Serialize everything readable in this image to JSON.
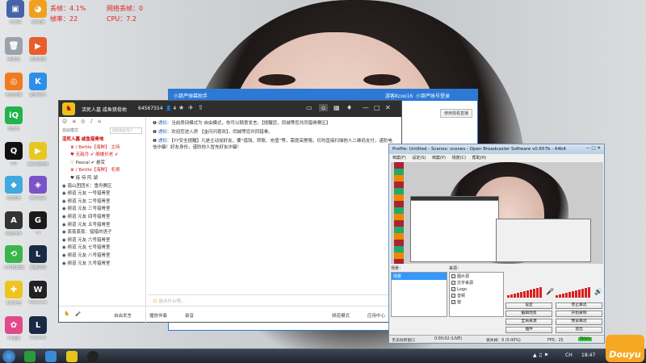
{
  "stats": {
    "dropped": "丢帧：4.1%",
    "lost": "网络丢帧：0",
    "fps": "帧率：22",
    "cpu": "CPU：7.2"
  },
  "desktop_icons": [
    "计算机",
    "Wi快速",
    "回收站",
    "迅雷直播",
    "热血直播",
    "酷狗音乐",
    "爱奇艺",
    "QQ",
    "腾讯播放器",
    "QQ群管",
    "腾讯会议",
    "数据分析",
    "YY",
    "英雄联盟",
    "小鸡模拟器",
    "WeGame",
    "360安全",
    "Internet",
    "YY语音",
    "我的电脑"
  ],
  "helper": {
    "title": "小葫芦弹幕助手",
    "user": "游客Kcoo16",
    "login": "小葫芦账号登录",
    "button": "使用观看直播"
  },
  "yy": {
    "title": "活死人墓 咸鱼猎骨地",
    "channel_id": "64567554",
    "online": "4",
    "tools": [
      "☺",
      "≡",
      "◎",
      "♪",
      "⌂"
    ],
    "mode_label": "自由模式",
    "search_placeholder": "搜索频道/用户",
    "channels": [
      {
        "text": "活死人墓 咸鱼猎骨地",
        "style": "hl"
      },
      {
        "text": "♛ / Bettle【海鲜】 主持",
        "style": "sub red"
      },
      {
        "text": "♥ 无敌月 ✔ 阁楼长老 ✔",
        "style": "sub red"
      },
      {
        "text": "♡ Pascal ✔ 悬赏",
        "style": "sub"
      },
      {
        "text": "♛ / Bettle【海鲜】 毛哥",
        "style": "sub red"
      },
      {
        "text": "♥ 接 待 阵 湖",
        "style": "sub"
      },
      {
        "text": "◉ 南山团团长：雪舟赛区",
        "style": ""
      },
      {
        "text": "◉ 频道 元友 一号猎骨室",
        "style": ""
      },
      {
        "text": "◉ 频道 元友 二号猎骨室",
        "style": ""
      },
      {
        "text": "◉ 频道 元友 三号猎骨室",
        "style": ""
      },
      {
        "text": "◉ 频道 元友 四号猎骨室",
        "style": ""
      },
      {
        "text": "◉ 频道 元友 五号猎骨室",
        "style": ""
      },
      {
        "text": "◉ 蒸蒸蒸蒸：猎猎的语子",
        "style": ""
      },
      {
        "text": "◉ 频道 元友 六号猎骨室",
        "style": ""
      },
      {
        "text": "◉ 频道 元友 七号猎骨室",
        "style": ""
      },
      {
        "text": "◉ 频道 元友 八号猎骨室",
        "style": ""
      },
      {
        "text": "◉ 频道 元友 九号猎骨室",
        "style": ""
      }
    ],
    "messages": [
      {
        "head": "通知：",
        "body": "当前房间模式为 自由模式，你可以随意发言。【提醒您，同城等您共同猎骨赛区】"
      },
      {
        "head": "通知：",
        "body": "欢迎您进入房 【金闪闪喜欢】，同城等您共同猎骨。"
      },
      {
        "head": "通知：",
        "body": "【YY安全提醒】凡是主动加好友，要“借钱、转账、充值”等，需提高警惕，切勿直接扫描他人二维码支付，谨防电信诈骗！好友身份，谨防他人冒充好友诈骗！"
      }
    ],
    "input_placeholder": "说点什么吧...",
    "bottom": {
      "free_talk": "自由发言",
      "play": "播放伴奏",
      "record": "录音",
      "mode": "频道模式",
      "app": "应用中心"
    }
  },
  "obs": {
    "title": "Profile: Untitled - Scenes: scenes - Open Broadcaster Software v0.657b - 64bit",
    "menu": [
      "档案(F)",
      "设定(S)",
      "档案(P)",
      "场景(C)",
      "帮助(H)"
    ],
    "scenes_label": "场景：",
    "sources_label": "来源：",
    "scenes": [
      "场景"
    ],
    "sources": [
      "图片源",
      "文字来源",
      "Logo",
      "音频",
      "窗"
    ],
    "buttons": [
      "设定",
      "停止串流",
      "编辑场景",
      "开始录制",
      "全局来源",
      "预览串流",
      "插件",
      "退出"
    ],
    "status": {
      "recording": "无法找到窗口",
      "time": "0:00:02 (LIVE)",
      "dropped": "丢失帧：0 (0.00%)",
      "fps": "FPS：25",
      "bitrate": "0kb/s"
    }
  },
  "taskbar": {
    "time": "18:47",
    "extra": "CH"
  },
  "colors": {
    "accent": "#2c7ad6",
    "stat_red": "#e02020",
    "douyu": "#f7a823"
  },
  "douyu_text": "Douyu"
}
